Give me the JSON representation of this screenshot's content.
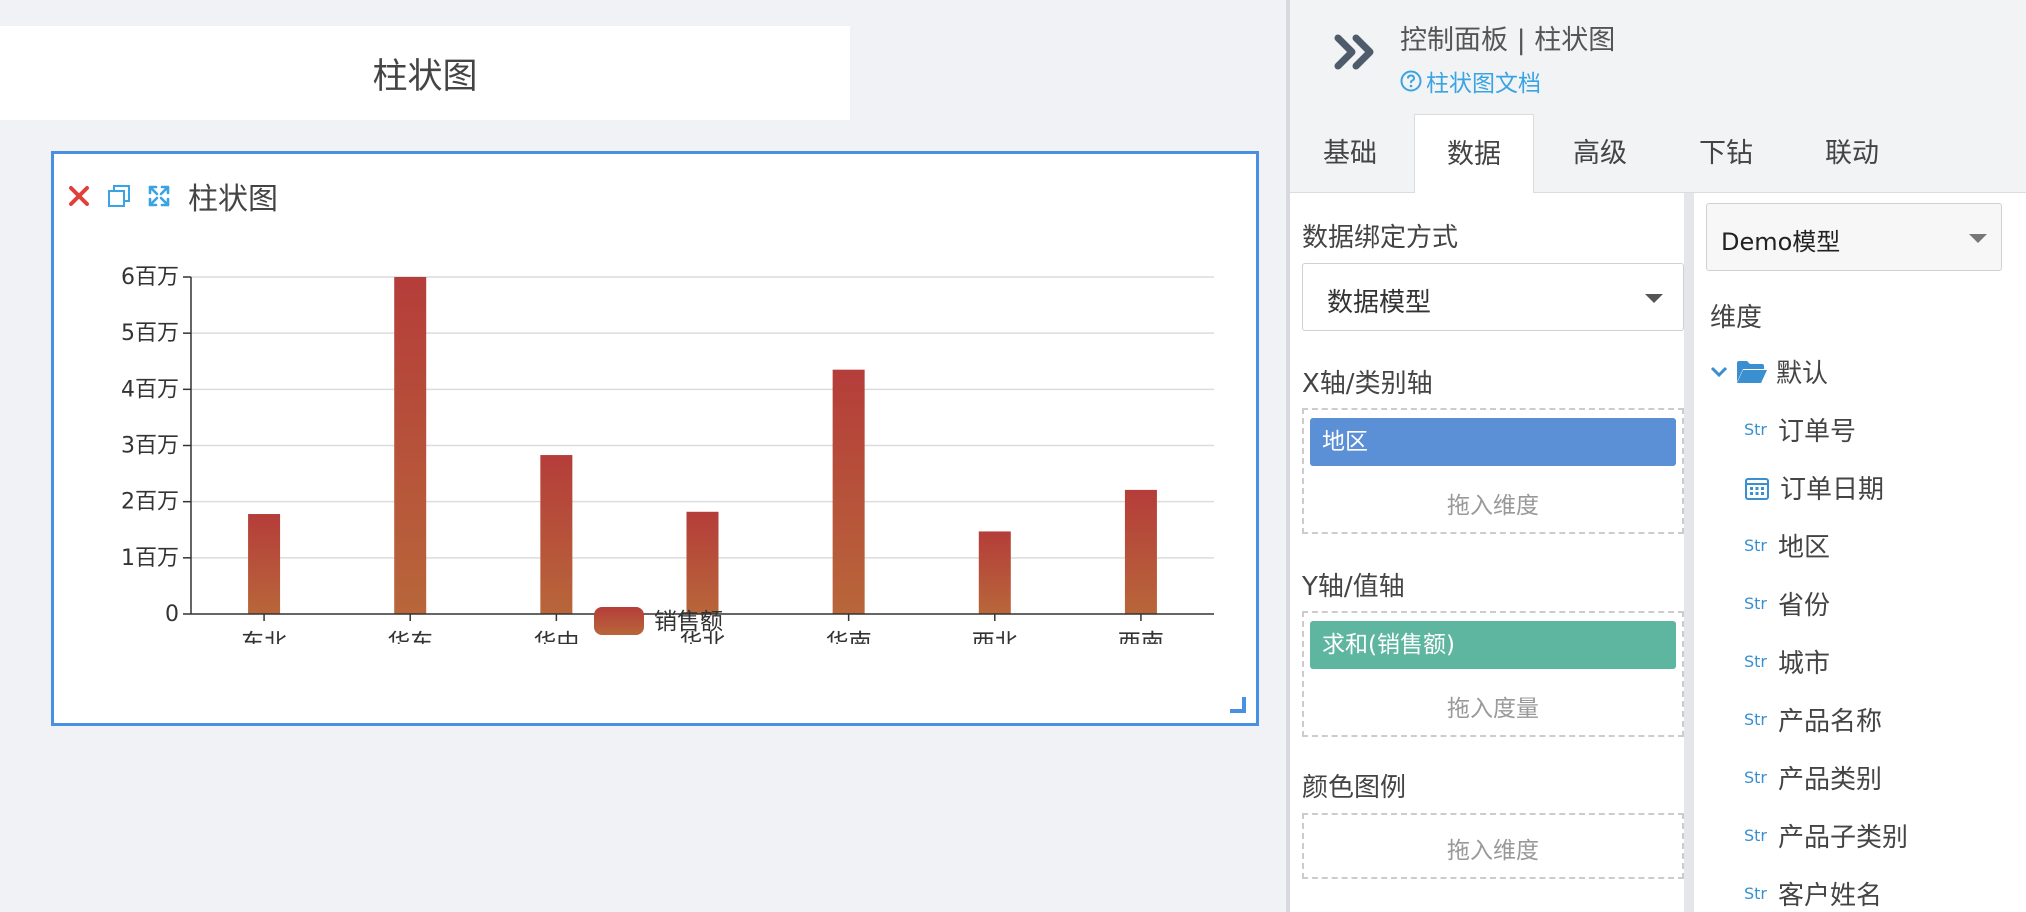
{
  "canvas": {
    "page_title": "柱状图",
    "widget": {
      "title": "柱状图",
      "icons": [
        "close-icon",
        "copy-icon",
        "fullscreen-icon"
      ]
    }
  },
  "chart_data": {
    "type": "bar",
    "categories": [
      "东北",
      "华东",
      "华中",
      "华北",
      "华南",
      "西北",
      "西南"
    ],
    "series": [
      {
        "name": "销售额",
        "values": [
          1780000,
          6000000,
          2830000,
          1820000,
          4350000,
          1470000,
          2210000
        ]
      }
    ],
    "yticks": [
      "0",
      "1百万",
      "2百万",
      "3百万",
      "4百万",
      "5百万",
      "6百万"
    ],
    "ylim": [
      0,
      6000000
    ],
    "grid": true,
    "legend_position": "bottom",
    "bar_color_top": "#b53d3a",
    "bar_color_bottom": "#b8663a"
  },
  "panel": {
    "title": "控制面板 | 柱状图",
    "doc_link": "柱状图文档",
    "tabs": [
      "基础",
      "数据",
      "高级",
      "下钻",
      "联动"
    ],
    "active_tab": "数据",
    "binding_label": "数据绑定方式",
    "binding_value": "数据模型",
    "x_axis": {
      "label": "X轴/类别轴",
      "chip": "地区",
      "hint": "拖入维度",
      "chip_color": "#5b8fd6"
    },
    "y_axis": {
      "label": "Y轴/值轴",
      "chip": "求和(销售额)",
      "hint": "拖入度量",
      "chip_color": "#5fb6a0"
    },
    "color_legend": {
      "label": "颜色图例",
      "hint": "拖入维度"
    },
    "model": "Demo模型",
    "dimension_label": "维度",
    "folder": "默认",
    "fields": [
      {
        "type": "Str",
        "name": "订单号"
      },
      {
        "type": "date",
        "name": "订单日期"
      },
      {
        "type": "Str",
        "name": "地区"
      },
      {
        "type": "Str",
        "name": "省份"
      },
      {
        "type": "Str",
        "name": "城市"
      },
      {
        "type": "Str",
        "name": "产品名称"
      },
      {
        "type": "Str",
        "name": "产品类别"
      },
      {
        "type": "Str",
        "name": "产品子类别"
      },
      {
        "type": "Str",
        "name": "客户姓名"
      }
    ]
  }
}
